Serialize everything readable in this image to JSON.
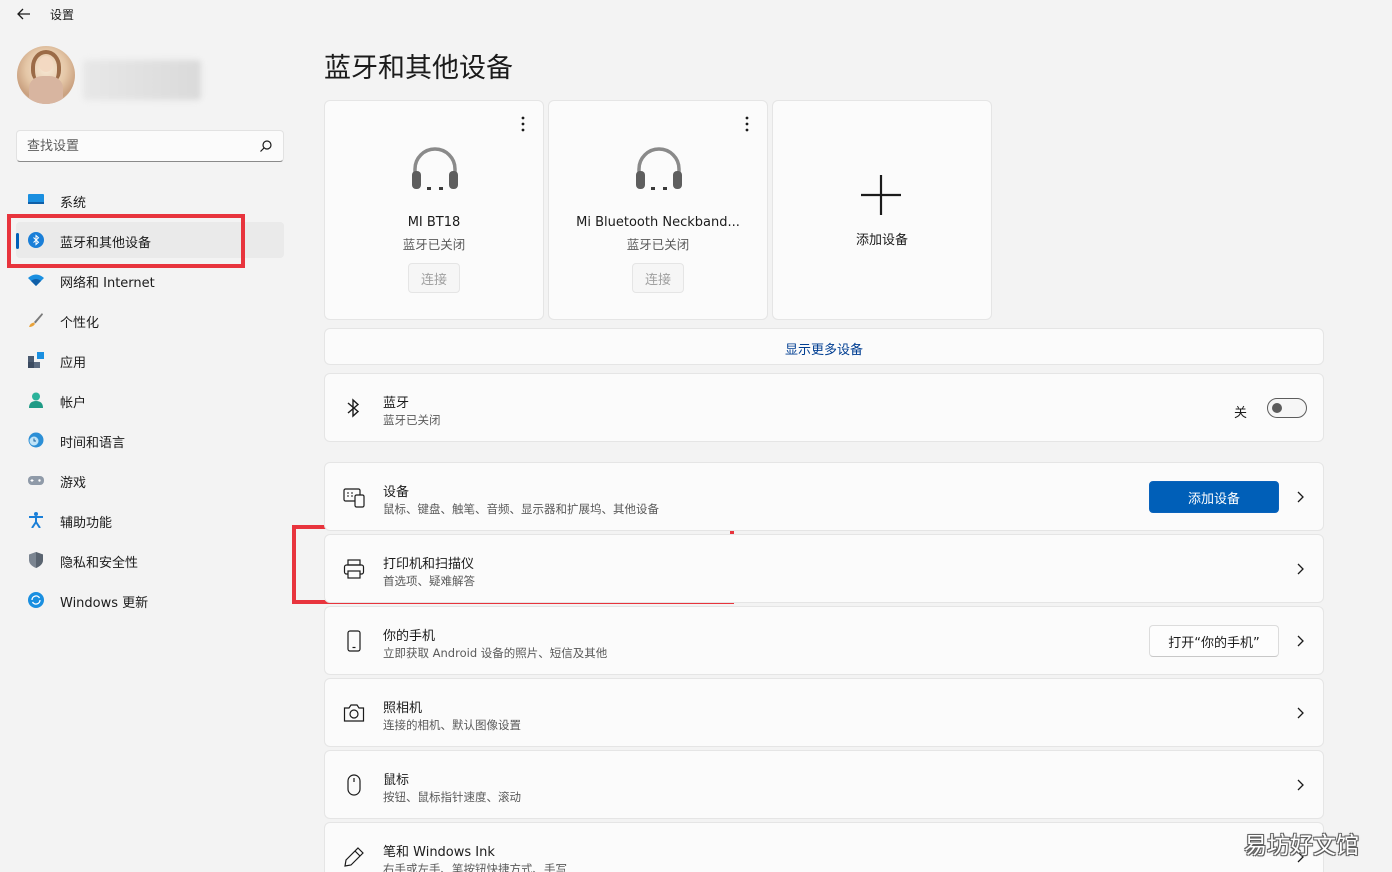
{
  "window": {
    "title": "设置"
  },
  "sidebar": {
    "search": {
      "placeholder": "查找设置"
    },
    "items": [
      {
        "label": "系统",
        "icon": "monitor-icon"
      },
      {
        "label": "蓝牙和其他设备",
        "icon": "bluetooth-icon",
        "active": true
      },
      {
        "label": "网络和 Internet",
        "icon": "wifi-icon"
      },
      {
        "label": "个性化",
        "icon": "brush-icon"
      },
      {
        "label": "应用",
        "icon": "apps-icon"
      },
      {
        "label": "帐户",
        "icon": "person-icon"
      },
      {
        "label": "时间和语言",
        "icon": "globe-clock-icon"
      },
      {
        "label": "游戏",
        "icon": "gamepad-icon"
      },
      {
        "label": "辅助功能",
        "icon": "accessibility-icon"
      },
      {
        "label": "隐私和安全性",
        "icon": "shield-icon"
      },
      {
        "label": "Windows 更新",
        "icon": "update-icon"
      }
    ]
  },
  "main": {
    "title": "蓝牙和其他设备",
    "devices": [
      {
        "name": "MI BT18",
        "status": "蓝牙已关闭",
        "connect_label": "连接",
        "icon": "headphones-icon"
      },
      {
        "name": "Mi Bluetooth Neckband...",
        "status": "蓝牙已关闭",
        "connect_label": "连接",
        "icon": "headphones-icon"
      }
    ],
    "add_device_card": {
      "label": "添加设备",
      "icon": "plus-icon"
    },
    "show_more": "显示更多设备",
    "bluetooth": {
      "title": "蓝牙",
      "subtitle": "蓝牙已关闭",
      "toggle_label": "关",
      "enabled": false,
      "icon": "bluetooth-icon"
    },
    "rows": [
      {
        "title": "设备",
        "subtitle": "鼠标、键盘、触笔、音频、显示器和扩展坞、其他设备",
        "button": "添加设备",
        "icon": "devices-icon"
      },
      {
        "title": "打印机和扫描仪",
        "subtitle": "首选项、疑难解答",
        "icon": "printer-icon"
      },
      {
        "title": "你的手机",
        "subtitle": "立即获取 Android 设备的照片、短信及其他",
        "button": "打开“你的手机”",
        "icon": "phone-icon"
      },
      {
        "title": "照相机",
        "subtitle": "连接的相机、默认图像设置",
        "icon": "camera-icon"
      },
      {
        "title": "鼠标",
        "subtitle": "按钮、鼠标指针速度、滚动",
        "icon": "mouse-icon"
      },
      {
        "title": "笔和 Windows Ink",
        "subtitle": "右手或左手、笔按钮快捷方式、手写",
        "icon": "pen-icon"
      }
    ]
  },
  "colors": {
    "accent": "#005fb8",
    "highlight": "#e8343d",
    "background": "#f3f3f3"
  },
  "watermark": "易坊好文馆"
}
